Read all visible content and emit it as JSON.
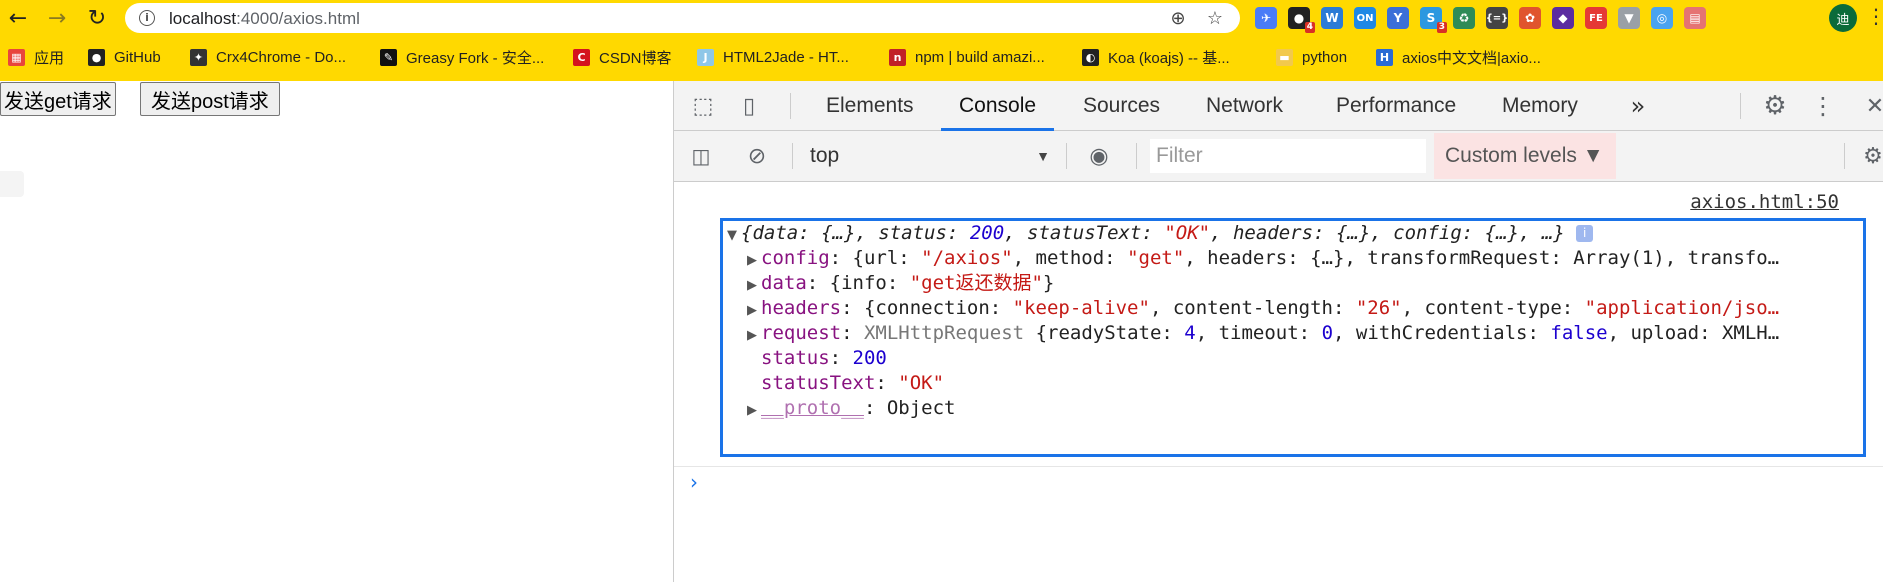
{
  "browser": {
    "url_host": "localhost",
    "url_path": ":4000/axios.html",
    "back_glyph": "←",
    "forward_glyph": "→",
    "reload_glyph": "↻",
    "avatar_text": "迪",
    "menu_glyph": "⋮",
    "extensions": [
      {
        "name": "ext-icon-1",
        "text": "✈",
        "color": "#4a7cf7"
      },
      {
        "name": "ext-icon-2",
        "text": "●",
        "color": "#222",
        "badge": "4"
      },
      {
        "name": "ext-icon-3",
        "text": "W",
        "color": "#2b7bd6"
      },
      {
        "name": "ext-icon-4",
        "text": "ON",
        "color": "#1e88e5"
      },
      {
        "name": "ext-icon-5",
        "text": "Y",
        "color": "#3b6fd8"
      },
      {
        "name": "ext-icon-6",
        "text": "S",
        "color": "#2c98e0",
        "badge": "3"
      },
      {
        "name": "ext-icon-7",
        "text": "♻",
        "color": "#2e8b57"
      },
      {
        "name": "ext-icon-8",
        "text": "{=}",
        "color": "#444"
      },
      {
        "name": "ext-icon-9",
        "text": "✿",
        "color": "#e0552d"
      },
      {
        "name": "ext-icon-10",
        "text": "◆",
        "color": "#5b2ca0"
      },
      {
        "name": "ext-icon-11",
        "text": "FE",
        "color": "#e53935"
      },
      {
        "name": "ext-icon-12",
        "text": "▼",
        "color": "#9aa0a6"
      },
      {
        "name": "ext-icon-13",
        "text": "◎",
        "color": "#4aa3f0"
      },
      {
        "name": "ext-icon-14",
        "text": "▤",
        "color": "#e57373"
      }
    ]
  },
  "bookmarks": [
    {
      "label": "应用",
      "icon": "apps-grid-icon",
      "icon_text": "▦",
      "icon_color": "#e8453c"
    },
    {
      "label": "GitHub",
      "icon": "github-icon",
      "icon_text": "●",
      "icon_color": "#222"
    },
    {
      "label": "Crx4Chrome - Do...",
      "icon": "crx4chrome-icon",
      "icon_text": "✦",
      "icon_color": "#333"
    },
    {
      "label": "Greasy Fork - 安全...",
      "icon": "greasyfork-icon",
      "icon_text": "✎",
      "icon_color": "#111"
    },
    {
      "label": "CSDN博客",
      "icon": "csdn-icon",
      "icon_text": "C",
      "icon_color": "#d4131e"
    },
    {
      "label": "HTML2Jade - HT...",
      "icon": "html2jade-icon",
      "icon_text": "J",
      "icon_color": "#8fc7e8"
    },
    {
      "label": "npm | build amazi...",
      "icon": "npm-icon",
      "icon_text": "n",
      "icon_color": "#c12127"
    },
    {
      "label": "Koa (koajs) -- 基...",
      "icon": "koa-icon",
      "icon_text": "◐",
      "icon_color": "#222"
    },
    {
      "label": "python",
      "icon": "folder-icon",
      "icon_text": "▬",
      "icon_color": "#f2c94c"
    },
    {
      "label": "axios中文文档|axio...",
      "icon": "axios-icon",
      "icon_text": "H",
      "icon_color": "#2a6bd4"
    }
  ],
  "page": {
    "get_button": "发送get请求",
    "post_button": "发送post请求"
  },
  "devtools": {
    "tabs": [
      "Elements",
      "Console",
      "Sources",
      "Network",
      "Performance",
      "Memory"
    ],
    "active_tab": "Console",
    "more_tabs_glyph": "»",
    "context": "top",
    "filter_placeholder": "Filter",
    "levels": "Custom levels ▼",
    "source_link": "axios.html:50",
    "prompt_glyph": "›"
  },
  "console_object": {
    "summary": [
      {
        "t": "{",
        "c": ""
      },
      {
        "t": "data",
        "c": ""
      },
      {
        "t": ": {…}, ",
        "c": ""
      },
      {
        "t": "status",
        "c": ""
      },
      {
        "t": ": ",
        "c": ""
      },
      {
        "t": "200",
        "c": "n"
      },
      {
        "t": ", ",
        "c": ""
      },
      {
        "t": "statusText",
        "c": ""
      },
      {
        "t": ": ",
        "c": ""
      },
      {
        "t": "\"OK\"",
        "c": "s"
      },
      {
        "t": ", ",
        "c": ""
      },
      {
        "t": "headers",
        "c": ""
      },
      {
        "t": ": {…}, ",
        "c": ""
      },
      {
        "t": "config",
        "c": ""
      },
      {
        "t": ": {…}, …}",
        "c": ""
      }
    ],
    "info_badge": "i",
    "rows": [
      {
        "expand": true,
        "parts": [
          {
            "t": "config",
            "c": "k"
          },
          {
            "t": ": {url: ",
            "c": ""
          },
          {
            "t": "\"/axios\"",
            "c": "s"
          },
          {
            "t": ", method: ",
            "c": ""
          },
          {
            "t": "\"get\"",
            "c": "s"
          },
          {
            "t": ", headers: {…}, transformRequest: Array(1), transfo…",
            "c": ""
          }
        ]
      },
      {
        "expand": true,
        "parts": [
          {
            "t": "data",
            "c": "k"
          },
          {
            "t": ": {info: ",
            "c": ""
          },
          {
            "t": "\"get返还数据\"",
            "c": "s"
          },
          {
            "t": "}",
            "c": ""
          }
        ]
      },
      {
        "expand": true,
        "parts": [
          {
            "t": "headers",
            "c": "k"
          },
          {
            "t": ": {connection: ",
            "c": ""
          },
          {
            "t": "\"keep-alive\"",
            "c": "s"
          },
          {
            "t": ", content-length: ",
            "c": ""
          },
          {
            "t": "\"26\"",
            "c": "s"
          },
          {
            "t": ", content-type: ",
            "c": ""
          },
          {
            "t": "\"application/jso…",
            "c": "s"
          }
        ]
      },
      {
        "expand": true,
        "parts": [
          {
            "t": "request",
            "c": "k"
          },
          {
            "t": ": ",
            "c": ""
          },
          {
            "t": "XMLHttpRequest",
            "c": "g"
          },
          {
            "t": " {readyState: ",
            "c": ""
          },
          {
            "t": "4",
            "c": "n"
          },
          {
            "t": ", timeout: ",
            "c": ""
          },
          {
            "t": "0",
            "c": "n"
          },
          {
            "t": ", withCredentials: ",
            "c": ""
          },
          {
            "t": "false",
            "c": "n"
          },
          {
            "t": ", upload: XMLH…",
            "c": ""
          }
        ]
      },
      {
        "expand": false,
        "parts": [
          {
            "t": "status",
            "c": "k"
          },
          {
            "t": ": ",
            "c": ""
          },
          {
            "t": "200",
            "c": "n"
          }
        ]
      },
      {
        "expand": false,
        "parts": [
          {
            "t": "statusText",
            "c": "k"
          },
          {
            "t": ": ",
            "c": ""
          },
          {
            "t": "\"OK\"",
            "c": "s"
          }
        ]
      },
      {
        "expand": true,
        "parts": [
          {
            "t": "__proto__",
            "c": "k"
          },
          {
            "t": ": Object",
            "c": ""
          }
        ]
      }
    ]
  },
  "colors": {
    "browser_frame": "#ffd900",
    "devtools_accent": "#1a73e8",
    "string": "#c41a16",
    "number": "#1c00cf",
    "key": "#881280"
  }
}
